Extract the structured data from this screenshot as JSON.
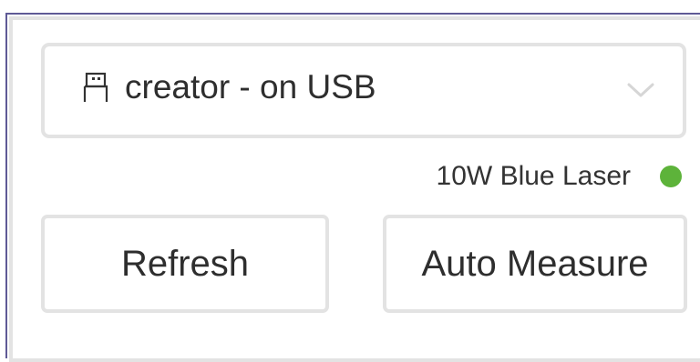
{
  "device_selector": {
    "icon": "usb-icon",
    "label": "creator - on USB",
    "chevron": "chevron-down-icon"
  },
  "laser_status": {
    "label": "10W Blue Laser",
    "status_color": "#5db33a"
  },
  "buttons": {
    "refresh_label": "Refresh",
    "auto_measure_label": "Auto Measure"
  },
  "colors": {
    "frame_accent": "#5f5a96",
    "border": "#e3e3e3",
    "text": "#2e2e2e"
  }
}
